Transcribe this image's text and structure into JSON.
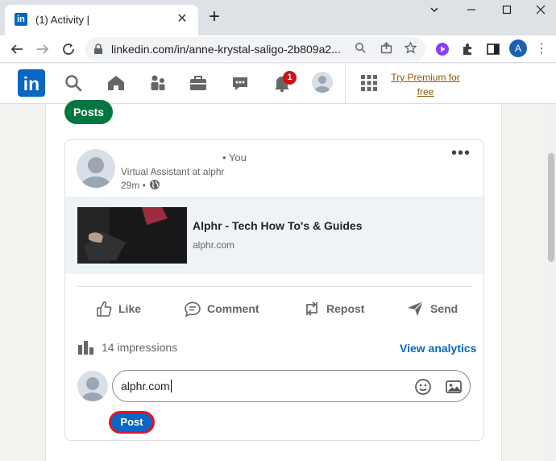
{
  "browser": {
    "tab_title": "(1) Activity |",
    "favicon_text": "in",
    "new_tab_label": "+",
    "url": "linkedin.com/in/anne-krystal-saligo-2b809a2...",
    "profile_initial": "A"
  },
  "header": {
    "logo_text": "in",
    "notification_count": "1",
    "premium_text": "Try Premium for free"
  },
  "section": {
    "posts_label": "Posts"
  },
  "post": {
    "author_degree": "• You",
    "author_headline": "Virtual Assistant at alphr",
    "time_ago": "29m •",
    "link_title": "Alphr - Tech How To's & Guides",
    "link_domain": "alphr.com"
  },
  "actions": {
    "like": "Like",
    "comment": "Comment",
    "repost": "Repost",
    "send": "Send"
  },
  "stats": {
    "impressions": "14 impressions",
    "analytics_label": "View analytics"
  },
  "comment": {
    "value": "alphr.com",
    "post_label": "Post"
  },
  "colors": {
    "linkedin_blue": "#0a66c2",
    "posts_green": "#057642",
    "premium_gold": "#915907",
    "highlight_red": "#e0142a"
  }
}
